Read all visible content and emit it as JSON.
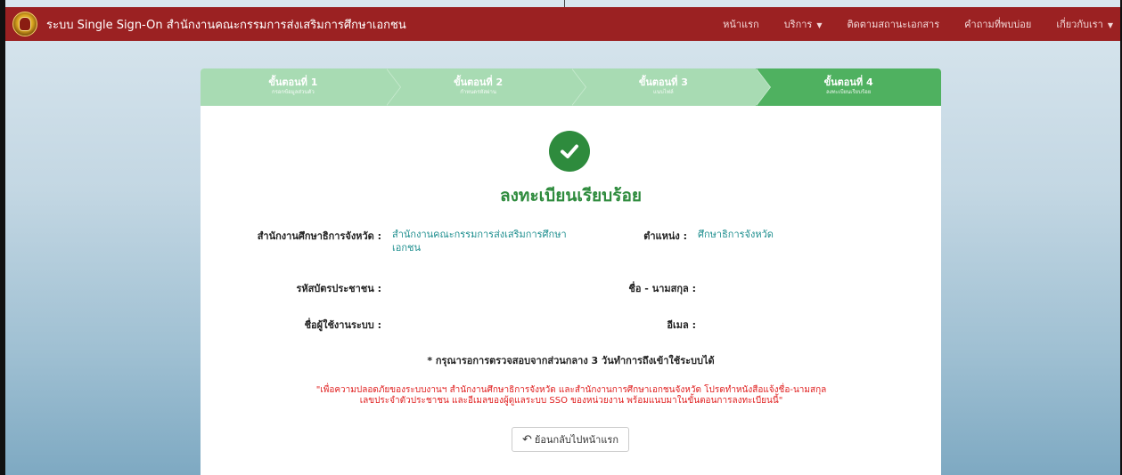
{
  "navbar": {
    "brand_title": "ระบบ Single Sign-On สำนักงานคณะกรรมการส่งเสริมการศึกษาเอกชน",
    "links": [
      {
        "label": "หน้าแรก"
      },
      {
        "label": "บริการ",
        "dropdown": true
      },
      {
        "label": "ติดตามสถานะเอกสาร"
      },
      {
        "label": "คำถามที่พบบ่อย"
      },
      {
        "label": "เกี่ยวกับเรา",
        "dropdown": true
      }
    ]
  },
  "steps": [
    {
      "title": "ขั้นตอนที่ 1",
      "subtitle": "กรอกข้อมูลส่วนตัว"
    },
    {
      "title": "ขั้นตอนที่ 2",
      "subtitle": "กำหนดรหัสผ่าน"
    },
    {
      "title": "ขั้นตอนที่ 3",
      "subtitle": "แนบไฟล์"
    },
    {
      "title": "ขั้นตอนที่ 4",
      "subtitle": "ลงทะเบียนเรียบร้อย"
    }
  ],
  "active_step": 4,
  "result": {
    "title": "ลงทะเบียนเรียบร้อย",
    "fields": {
      "office_label": "สำนักงานศึกษาธิการจังหวัด :",
      "office_value": "สำนักงานคณะกรรมการส่งเสริมการศึกษาเอกชน",
      "position_label": "ตำแหน่ง :",
      "position_value": "ศึกษาธิการจังหวัด",
      "citizen_id_label": "รหัสบัตรประชาชน :",
      "citizen_id_value": "",
      "fullname_label": "ชื่อ - นามสกุล :",
      "fullname_value": "",
      "username_label": "ชื่อผู้ใช้งานระบบ :",
      "username_value": "",
      "email_label": "อีเมล :",
      "email_value": ""
    },
    "notice": "* กรุณารอการตรวจสอบจากส่วนกลาง 3 วันทำการถึงเข้าใช้ระบบได้",
    "warning_line1": "\"เพื่อความปลอดภัยของระบบงานฯ สำนักงานศึกษาธิการจังหวัด และสำนักงานการศึกษาเอกชนจังหวัด โปรดทำหนังสือแจ้งชื่อ-นามสกุล",
    "warning_line2": "เลขประจำตัวประชาชน และอีเมลของผู้ดูแลระบบ SSO ของหน่วยงาน พร้อมแนบมาในขั้นตอนการลงทะเบียนนี้\"",
    "back_button": "ย้อนกลับไปหน้าแรก"
  },
  "colors": {
    "navbar": "#9b2122",
    "step_inactive": "#a8dbb3",
    "step_active": "#4fb160",
    "success": "#2e8b3d",
    "warning": "#e02020",
    "value_link": "#1f8f8f"
  },
  "icons": {
    "check": "check-circle-icon",
    "back": "undo-icon",
    "caret": "caret-down-icon"
  }
}
